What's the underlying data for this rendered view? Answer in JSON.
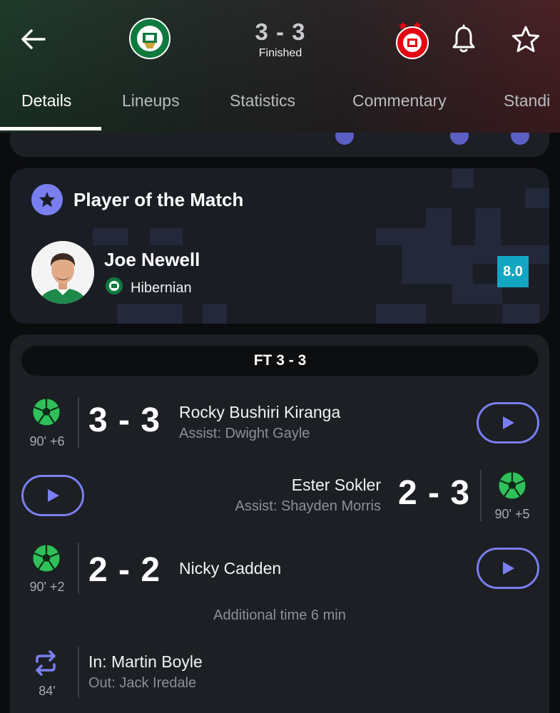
{
  "header": {
    "home_team": "Hibernian",
    "away_team": "Aberdeen",
    "score": "3 - 3",
    "status": "Finished",
    "colors": {
      "home": "#1f3a2a",
      "away": "#4a2125"
    }
  },
  "icons": {
    "back": "arrow-left-icon",
    "notify": "bell-icon",
    "favorite": "star-icon"
  },
  "tabs": [
    {
      "label": "Details",
      "active": true
    },
    {
      "label": "Lineups",
      "active": false
    },
    {
      "label": "Statistics",
      "active": false
    },
    {
      "label": "Commentary",
      "active": false
    },
    {
      "label": "Standi",
      "active": false
    }
  ],
  "potm": {
    "title": "Player of the Match",
    "player": "Joe Newell",
    "team": "Hibernian",
    "rating": "8.0",
    "rating_color": "#12a6c3"
  },
  "events": {
    "ft_label": "FT 3 - 3",
    "items": [
      {
        "type": "goal",
        "side": "home",
        "minute": "90' +6",
        "score": "3 - 3",
        "player": "Rocky Bushiri Kiranga",
        "assist": "Assist: Dwight Gayle"
      },
      {
        "type": "goal",
        "side": "away",
        "minute": "90' +5",
        "score": "2 - 3",
        "player": "Ester Sokler",
        "assist": "Assist: Shayden Morris"
      },
      {
        "type": "goal",
        "side": "home",
        "minute": "90' +2",
        "score": "2 - 2",
        "player": "Nicky Cadden",
        "assist": ""
      }
    ],
    "added_time": "Additional time 6 min",
    "substitution": {
      "minute": "84'",
      "in": "In: Martin Boyle",
      "out": "Out: Jack Iredale"
    }
  },
  "accent_color": "#7a7ff0"
}
